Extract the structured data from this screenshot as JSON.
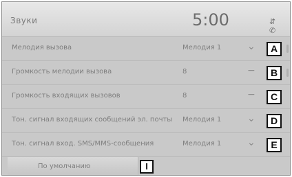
{
  "header": {
    "title": "Звуки",
    "clock": "5:00",
    "status_icons": "⇵ ✆"
  },
  "rows": [
    {
      "label": "Мелодия вызова",
      "value": "Мелодия 1",
      "chevron": "⌄",
      "callout": "A"
    },
    {
      "label": "Громкость мелодии вызова",
      "value": "8",
      "chevron": "−",
      "callout": "B"
    },
    {
      "label": "Громкость входящих вызовов",
      "value": "8",
      "chevron": "−",
      "callout": "C"
    },
    {
      "label": "Тон. сигнал входящих сообщений эл. почты",
      "value": "Мелодия 1",
      "chevron": "⌄",
      "callout": "D"
    },
    {
      "label": "Тон. сигнал вход. SMS/MMS-сообщения",
      "value": "Мелодия 1",
      "chevron": "⌄",
      "callout": "E"
    }
  ],
  "footer": {
    "default_label": "По умолчанию",
    "callout": "I"
  }
}
